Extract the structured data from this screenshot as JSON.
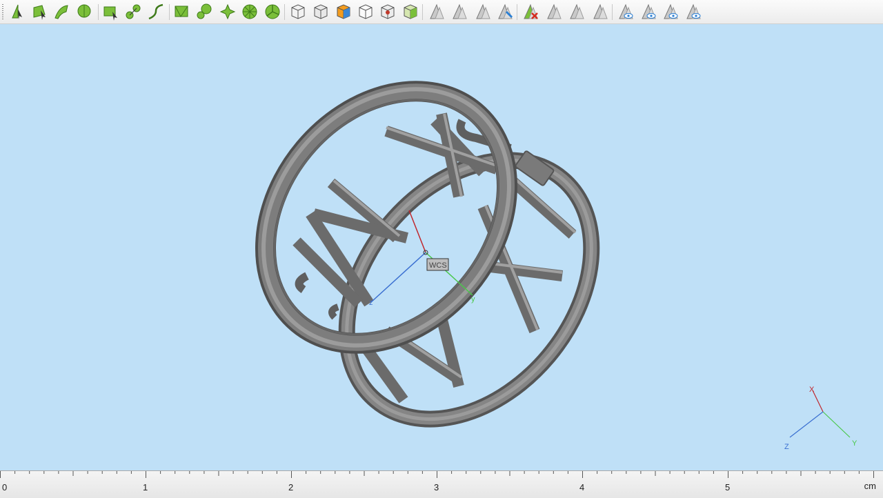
{
  "toolbar": {
    "buttons": [
      {
        "name": "select-vertex-tool",
        "icon": "vertex-select-icon"
      },
      {
        "name": "select-face-tool",
        "icon": "face-select-icon"
      },
      {
        "name": "select-edge-tool",
        "icon": "edge-select-icon"
      },
      {
        "name": "select-solid-tool",
        "icon": "solid-select-icon"
      },
      {
        "name": "rectangle-tool",
        "icon": "rectangle-icon"
      },
      {
        "name": "connect-tool",
        "icon": "connect-icon"
      },
      {
        "name": "curve-tool",
        "icon": "curve-icon"
      },
      {
        "name": "mesh-face-tool",
        "icon": "mesh-face-icon"
      },
      {
        "name": "node-tool",
        "icon": "node-icon"
      },
      {
        "name": "star-tool",
        "icon": "star-icon"
      },
      {
        "name": "wheel-tool",
        "icon": "wheel-icon"
      },
      {
        "name": "fan-tool",
        "icon": "fan-icon"
      },
      {
        "name": "cube-select-tool",
        "icon": "cube-icon"
      },
      {
        "name": "cube-face-tool",
        "icon": "cube-face-icon"
      },
      {
        "name": "cube-color-tool",
        "icon": "cube-color-icon"
      },
      {
        "name": "cube-outline-tool",
        "icon": "cube-outline-icon"
      },
      {
        "name": "cube-target-tool",
        "icon": "cube-target-icon"
      },
      {
        "name": "cube-mesh-tool",
        "icon": "cube-mesh-icon"
      },
      {
        "name": "triangle-select-tool",
        "icon": "triangle-icon"
      },
      {
        "name": "triangle-edit-tool",
        "icon": "triangle-edit-icon"
      },
      {
        "name": "triangle-pick-tool",
        "icon": "triangle-pick-icon"
      },
      {
        "name": "triangle-blue-tool",
        "icon": "triangle-blue-icon"
      },
      {
        "name": "delete-triangle-tool",
        "icon": "delete-triangle-icon"
      },
      {
        "name": "triangle-split-tool",
        "icon": "triangle-split-icon"
      },
      {
        "name": "triangle-copy-tool",
        "icon": "triangle-copy-icon"
      },
      {
        "name": "triangle-flat-tool",
        "icon": "triangle-flat-icon"
      },
      {
        "name": "view-hidden-tool",
        "icon": "eye-triangle-icon"
      },
      {
        "name": "view-wire-tool",
        "icon": "eye-wire-icon"
      },
      {
        "name": "view-shade-tool",
        "icon": "eye-shade-icon"
      },
      {
        "name": "view-box-tool",
        "icon": "eye-box-icon"
      }
    ]
  },
  "viewport": {
    "wcs_label": "WCS",
    "wcs_axes": {
      "y": "y",
      "z": "z"
    },
    "triad": {
      "x": "X",
      "y": "Y",
      "z": "Z"
    },
    "background": "#bfe0f7"
  },
  "ruler": {
    "labels": [
      "0",
      "1",
      "2",
      "3",
      "4",
      "5"
    ],
    "unit": "cm"
  }
}
